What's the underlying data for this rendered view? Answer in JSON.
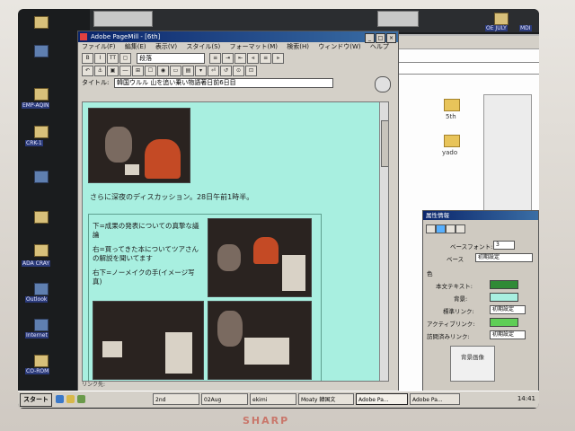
{
  "monitor": {
    "brand": "SHARP"
  },
  "desktop": {
    "icons": [
      "EMP-AQIN",
      "CRK-1",
      "ADA CRAY",
      "Outlook",
      "Internet",
      "CO-ROM"
    ],
    "top_folders": [
      "OE JULY",
      "MDI"
    ]
  },
  "explorer": {
    "folders": [
      "5th",
      "yado"
    ]
  },
  "pagemill": {
    "title": "Adobe PageMill - [6th]",
    "menu": [
      "ファイル(F)",
      "編集(E)",
      "表示(V)",
      "スタイル(S)",
      "フォーマット(M)",
      "検索(H)",
      "ウィンドウ(W)",
      "ヘルプ(H)"
    ],
    "style_select": "段落",
    "title_label": "タイトル:",
    "title_value": "韓国ウルル 山を追い乗い物語著日前6日目",
    "content": {
      "caption": "さらに深夜のディスカッション。28日午前1時半。",
      "cell_text_1": "下=成果の発表についての真摯な議論",
      "cell_text_2": "右=買ってきた本についてツアさんの解説を聞いてます",
      "cell_text_3": "右下=ノーメイクの手(イメージ写真)"
    },
    "link_label": "リンク先:"
  },
  "properties": {
    "title": "属性情報",
    "base_font_label": "ベースフォント:",
    "base_font_value": "3",
    "base_label": "ベース",
    "base_value": "初期設定",
    "color_label": "色",
    "text_label": "本文テキスト:",
    "bg_label": "背景:",
    "link_label": "標準リンク:",
    "link_value": "初期設定",
    "active_link_label": "アクティブリンク:",
    "visited_link_label": "訪問済みリンク:",
    "visited_link_value": "初期設定",
    "bg_image_label": "背景画像",
    "colors": {
      "text": "#2f8a36",
      "bg": "#a8efe0",
      "active": "#5fce55"
    }
  },
  "taskbar": {
    "start": "スタート",
    "items": [
      "2nd",
      "02Aug",
      "ekimi",
      "Moaty 韓国文",
      "Adobe Pa...",
      "Adobe Pa..."
    ],
    "clock": "14:41"
  }
}
